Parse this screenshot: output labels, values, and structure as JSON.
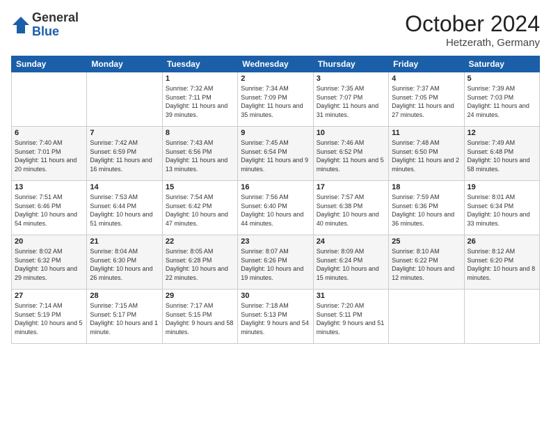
{
  "header": {
    "logo_general": "General",
    "logo_blue": "Blue",
    "month_title": "October 2024",
    "location": "Hetzerath, Germany"
  },
  "days_of_week": [
    "Sunday",
    "Monday",
    "Tuesday",
    "Wednesday",
    "Thursday",
    "Friday",
    "Saturday"
  ],
  "weeks": [
    [
      {
        "day": "",
        "info": ""
      },
      {
        "day": "",
        "info": ""
      },
      {
        "day": "1",
        "info": "Sunrise: 7:32 AM\nSunset: 7:11 PM\nDaylight: 11 hours\nand 39 minutes."
      },
      {
        "day": "2",
        "info": "Sunrise: 7:34 AM\nSunset: 7:09 PM\nDaylight: 11 hours\nand 35 minutes."
      },
      {
        "day": "3",
        "info": "Sunrise: 7:35 AM\nSunset: 7:07 PM\nDaylight: 11 hours\nand 31 minutes."
      },
      {
        "day": "4",
        "info": "Sunrise: 7:37 AM\nSunset: 7:05 PM\nDaylight: 11 hours\nand 27 minutes."
      },
      {
        "day": "5",
        "info": "Sunrise: 7:39 AM\nSunset: 7:03 PM\nDaylight: 11 hours\nand 24 minutes."
      }
    ],
    [
      {
        "day": "6",
        "info": "Sunrise: 7:40 AM\nSunset: 7:01 PM\nDaylight: 11 hours\nand 20 minutes."
      },
      {
        "day": "7",
        "info": "Sunrise: 7:42 AM\nSunset: 6:59 PM\nDaylight: 11 hours\nand 16 minutes."
      },
      {
        "day": "8",
        "info": "Sunrise: 7:43 AM\nSunset: 6:56 PM\nDaylight: 11 hours\nand 13 minutes."
      },
      {
        "day": "9",
        "info": "Sunrise: 7:45 AM\nSunset: 6:54 PM\nDaylight: 11 hours\nand 9 minutes."
      },
      {
        "day": "10",
        "info": "Sunrise: 7:46 AM\nSunset: 6:52 PM\nDaylight: 11 hours\nand 5 minutes."
      },
      {
        "day": "11",
        "info": "Sunrise: 7:48 AM\nSunset: 6:50 PM\nDaylight: 11 hours\nand 2 minutes."
      },
      {
        "day": "12",
        "info": "Sunrise: 7:49 AM\nSunset: 6:48 PM\nDaylight: 10 hours\nand 58 minutes."
      }
    ],
    [
      {
        "day": "13",
        "info": "Sunrise: 7:51 AM\nSunset: 6:46 PM\nDaylight: 10 hours\nand 54 minutes."
      },
      {
        "day": "14",
        "info": "Sunrise: 7:53 AM\nSunset: 6:44 PM\nDaylight: 10 hours\nand 51 minutes."
      },
      {
        "day": "15",
        "info": "Sunrise: 7:54 AM\nSunset: 6:42 PM\nDaylight: 10 hours\nand 47 minutes."
      },
      {
        "day": "16",
        "info": "Sunrise: 7:56 AM\nSunset: 6:40 PM\nDaylight: 10 hours\nand 44 minutes."
      },
      {
        "day": "17",
        "info": "Sunrise: 7:57 AM\nSunset: 6:38 PM\nDaylight: 10 hours\nand 40 minutes."
      },
      {
        "day": "18",
        "info": "Sunrise: 7:59 AM\nSunset: 6:36 PM\nDaylight: 10 hours\nand 36 minutes."
      },
      {
        "day": "19",
        "info": "Sunrise: 8:01 AM\nSunset: 6:34 PM\nDaylight: 10 hours\nand 33 minutes."
      }
    ],
    [
      {
        "day": "20",
        "info": "Sunrise: 8:02 AM\nSunset: 6:32 PM\nDaylight: 10 hours\nand 29 minutes."
      },
      {
        "day": "21",
        "info": "Sunrise: 8:04 AM\nSunset: 6:30 PM\nDaylight: 10 hours\nand 26 minutes."
      },
      {
        "day": "22",
        "info": "Sunrise: 8:05 AM\nSunset: 6:28 PM\nDaylight: 10 hours\nand 22 minutes."
      },
      {
        "day": "23",
        "info": "Sunrise: 8:07 AM\nSunset: 6:26 PM\nDaylight: 10 hours\nand 19 minutes."
      },
      {
        "day": "24",
        "info": "Sunrise: 8:09 AM\nSunset: 6:24 PM\nDaylight: 10 hours\nand 15 minutes."
      },
      {
        "day": "25",
        "info": "Sunrise: 8:10 AM\nSunset: 6:22 PM\nDaylight: 10 hours\nand 12 minutes."
      },
      {
        "day": "26",
        "info": "Sunrise: 8:12 AM\nSunset: 6:20 PM\nDaylight: 10 hours\nand 8 minutes."
      }
    ],
    [
      {
        "day": "27",
        "info": "Sunrise: 7:14 AM\nSunset: 5:19 PM\nDaylight: 10 hours\nand 5 minutes."
      },
      {
        "day": "28",
        "info": "Sunrise: 7:15 AM\nSunset: 5:17 PM\nDaylight: 10 hours\nand 1 minute."
      },
      {
        "day": "29",
        "info": "Sunrise: 7:17 AM\nSunset: 5:15 PM\nDaylight: 9 hours\nand 58 minutes."
      },
      {
        "day": "30",
        "info": "Sunrise: 7:18 AM\nSunset: 5:13 PM\nDaylight: 9 hours\nand 54 minutes."
      },
      {
        "day": "31",
        "info": "Sunrise: 7:20 AM\nSunset: 5:11 PM\nDaylight: 9 hours\nand 51 minutes."
      },
      {
        "day": "",
        "info": ""
      },
      {
        "day": "",
        "info": ""
      }
    ]
  ]
}
